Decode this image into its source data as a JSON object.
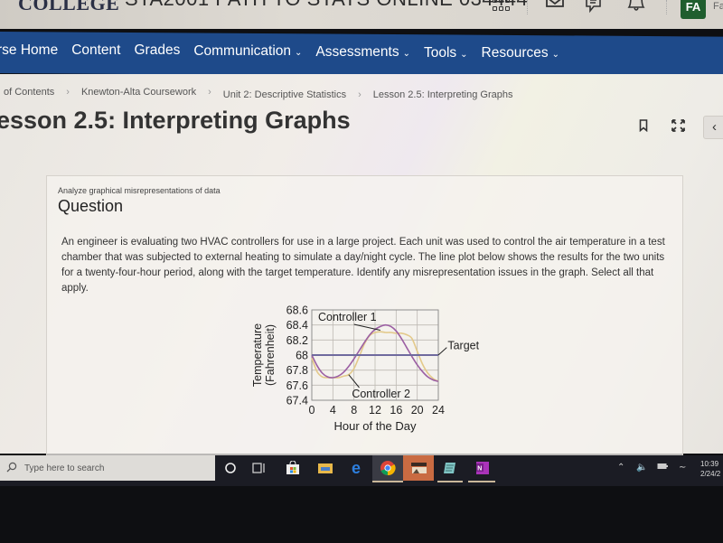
{
  "header": {
    "logo": "COLLEGE",
    "course_title": "STA2001 PATH TO STATS ONLINE 034444",
    "icons": [
      "apps-grid-icon",
      "mail-icon",
      "chat-icon",
      "bell-icon"
    ],
    "avatar_initials": "FA",
    "avatar_name_partial": "Fa",
    "avatar_color": "#1f5e2e"
  },
  "nav": {
    "color": "#1e4a8a",
    "items": [
      {
        "label": "rse Home",
        "dropdown": false
      },
      {
        "label": "Content",
        "dropdown": false
      },
      {
        "label": "Grades",
        "dropdown": false
      },
      {
        "label": "Communication",
        "dropdown": true
      },
      {
        "label": "Assessments",
        "dropdown": true
      },
      {
        "label": "Tools",
        "dropdown": true
      },
      {
        "label": "Resources",
        "dropdown": true
      }
    ]
  },
  "breadcrumb": [
    "of Contents",
    "Knewton-Alta Coursework",
    "Unit 2: Descriptive Statistics",
    "Lesson 2.5: Interpreting Graphs"
  ],
  "page": {
    "title": "esson 2.5: Interpreting Graphs",
    "icons": [
      "bookmark-icon",
      "fullscreen-icon",
      "collapse-chevron-icon"
    ]
  },
  "question": {
    "subtitle": "Analyze graphical misrepresentations of data",
    "heading": "Question",
    "text": "An engineer is evaluating two HVAC controllers for use in a large project. Each unit was used to control the air temperature in a test chamber that was subjected to external heating to simulate a day/night cycle. The line plot below shows the results for the two units for a twenty-four-hour period, along with the target temperature. Identify any misrepresentation issues in the graph. Select all that apply."
  },
  "chart_data": {
    "type": "line",
    "title": "",
    "xlabel": "Hour of the Day",
    "ylabel": "Temperature (Fahrenheit)",
    "xlim": [
      0,
      24
    ],
    "ylim": [
      67.4,
      68.6
    ],
    "xticks": [
      0,
      4,
      8,
      12,
      16,
      20,
      24
    ],
    "yticks": [
      "67.4",
      "67.6",
      "67.8",
      "68",
      "68.2",
      "68.4",
      "68.6"
    ],
    "grid": true,
    "series": [
      {
        "name": "Controller 1",
        "color": "#9b5fa3",
        "x": [
          0,
          1,
          2,
          3,
          4,
          5,
          6,
          7,
          8,
          9,
          10,
          11,
          12,
          13,
          14,
          15,
          16,
          17,
          18,
          19,
          20,
          21,
          22,
          23,
          24
        ],
        "y": [
          68.0,
          67.86,
          67.76,
          67.71,
          67.7,
          67.72,
          67.77,
          67.85,
          67.95,
          68.06,
          68.17,
          68.27,
          68.34,
          68.38,
          68.4,
          68.38,
          68.32,
          68.22,
          68.1,
          67.98,
          67.87,
          67.78,
          67.71,
          67.67,
          67.65
        ]
      },
      {
        "name": "Controller 2",
        "color": "#e3c98a",
        "x": [
          0,
          1,
          2,
          3,
          4,
          5,
          6,
          7,
          8,
          9,
          10,
          11,
          12,
          13,
          14,
          15,
          16,
          17,
          18,
          19,
          20,
          21,
          22,
          23,
          24
        ],
        "y": [
          67.96,
          67.78,
          67.71,
          67.7,
          67.7,
          67.7,
          67.72,
          67.74,
          67.82,
          67.98,
          68.15,
          68.26,
          68.3,
          68.31,
          68.3,
          68.3,
          68.29,
          68.29,
          68.27,
          68.22,
          68.05,
          67.88,
          67.76,
          67.69,
          67.65
        ]
      },
      {
        "name": "Target",
        "color": "#6f6a9e",
        "x": [
          0,
          24
        ],
        "y": [
          68.0,
          68.0
        ]
      }
    ],
    "annotations": [
      "Controller 1",
      "Controller 2",
      "Target"
    ]
  },
  "taskbar": {
    "search_placeholder": "Type here to search",
    "apps": [
      "cortana-icon",
      "task-view-icon",
      "store-icon",
      "file-explorer-icon",
      "edge-icon",
      "chrome-icon",
      "photos-app-icon",
      "notepad-icon",
      "onenote-icon"
    ],
    "clock_time": "10:39",
    "clock_date": "2/24/2"
  }
}
